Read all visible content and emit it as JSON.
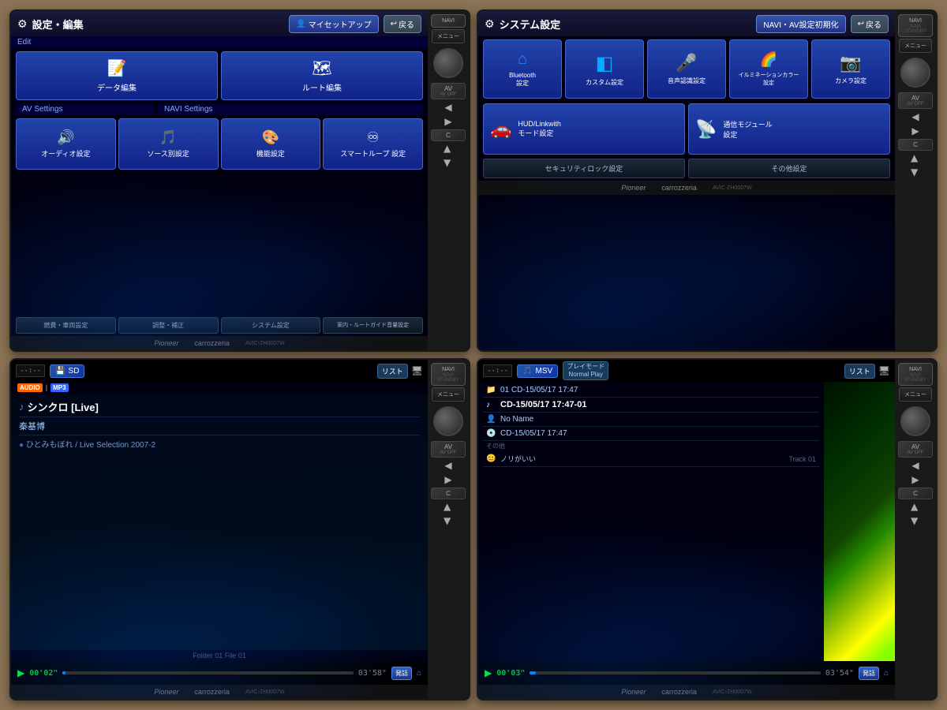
{
  "panels": [
    {
      "id": "panel1",
      "type": "settings-edit",
      "header": {
        "icon": "⚙",
        "title": "設定・編集",
        "my_setup_label": "マイセットアップ",
        "back_label": "戻る"
      },
      "edit_section_label": "Edit",
      "edit_buttons": [
        {
          "label": "データ編集",
          "icon": "📝"
        },
        {
          "label": "ルート編集",
          "icon": "🗺"
        }
      ],
      "av_section_label": "AV Settings",
      "navi_section_label": "NAVI Settings",
      "av_buttons": [
        {
          "label": "オーディオ設定",
          "icon": "🔊"
        },
        {
          "label": "ソース別設定",
          "icon": "🎵"
        }
      ],
      "navi_buttons": [
        {
          "label": "機能設定",
          "icon": "🎨"
        },
        {
          "label": "スマートループ 設定",
          "icon": "♾"
        }
      ],
      "bottom_tabs": [
        "燃費・車両設定",
        "調整・補正",
        "システム設定",
        "案内・ルートガイド音量設定"
      ]
    },
    {
      "id": "panel2",
      "type": "system-settings",
      "header": {
        "icon": "⚙",
        "title": "システム設定",
        "reset_label": "NAVI・AV設定初期化",
        "back_label": "戻る"
      },
      "grid_buttons": [
        {
          "label": "Bluetooth\n設定",
          "type": "bluetooth"
        },
        {
          "label": "カスタム設定",
          "type": "custom"
        },
        {
          "label": "音声認識設定",
          "type": "mic"
        },
        {
          "label": "イルミネーションカラー\n設定",
          "type": "illumination"
        },
        {
          "label": "カメラ設定",
          "type": "camera"
        }
      ],
      "row2_buttons": [
        {
          "label": "HUD/Linkwith\nモード設定",
          "type": "hud"
        },
        {
          "label": "通信モジュール\n設定",
          "type": "module"
        }
      ],
      "bottom_tabs": [
        "セキュリティロック設定",
        "その他設定"
      ]
    },
    {
      "id": "panel3",
      "type": "audio-player-sd",
      "header": {
        "time": "--:--",
        "source": "SD",
        "source_icon": "💾",
        "list_label": "リスト",
        "audio_tag": "AUDIO",
        "mp3_tag": "MP3"
      },
      "track": {
        "title": "シンクロ [Live]",
        "artist": "秦基博",
        "album": "ひとみもぼれ / Live Selection 2007-2"
      },
      "folder_info": "Folder 01  File 01",
      "playback": {
        "current_time": "00'02\"",
        "total_time": "03'58\"",
        "progress_percent": 1,
        "call_label": "発話",
        "bt_icon": "⌂"
      }
    },
    {
      "id": "panel4",
      "type": "msv-player",
      "header": {
        "time": "--:--",
        "source": "MSV",
        "source_icon": "🎵",
        "play_mode_label": "プレイモード",
        "play_mode_value": "Normal Play",
        "list_label": "リスト"
      },
      "tracks": [
        {
          "icon": "📁",
          "label": "01 CD-15/05/17 17:47",
          "type": "folder"
        },
        {
          "icon": "♪",
          "label": "CD-15/05/17 17:47-01",
          "type": "track",
          "active": true
        },
        {
          "icon": "👤",
          "label": "No Name",
          "type": "name"
        },
        {
          "icon": "💿",
          "label": "CD-15/05/17 17:47",
          "type": "disc"
        },
        {
          "icon": "≡",
          "label": "その他",
          "type": "meta"
        },
        {
          "icon": "😊",
          "label": "ノリがいい",
          "type": "mood",
          "extra": "Track  01"
        }
      ],
      "playback": {
        "current_time": "00'03\"",
        "total_time": "03'54\"",
        "progress_percent": 2,
        "call_label": "発話",
        "bt_icon": "⌂"
      }
    }
  ],
  "pioneer_label": "Pioneer",
  "carrozzeria_label": "carrozzeria",
  "model_label": "AVIC-ZH0007W",
  "navi_label": "NAVI",
  "navi_standby": "NAVI STANDBY",
  "menu_label": "メニュー",
  "av_label": "AV",
  "av_off": "AV OFF",
  "c_label": "C"
}
